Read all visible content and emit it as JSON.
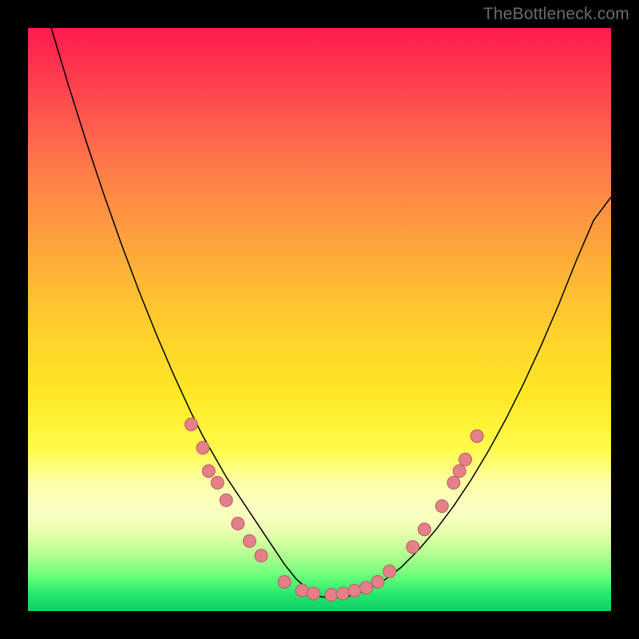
{
  "watermark": "TheBottleneck.com",
  "chart_data": {
    "type": "line",
    "title": "",
    "xlabel": "",
    "ylabel": "",
    "xlim": [
      0,
      100
    ],
    "ylim": [
      0,
      100
    ],
    "grid": false,
    "series": [
      {
        "name": "curve",
        "color": "#000000",
        "stroke_width": 1.5,
        "x": [
          4,
          7,
          10,
          13,
          16,
          19,
          22,
          25,
          28,
          30,
          32,
          34,
          36,
          38,
          40,
          42,
          44,
          46,
          48,
          50,
          52,
          55,
          58,
          61,
          64,
          67,
          70,
          73,
          76,
          79,
          82,
          85,
          88,
          91,
          94,
          97,
          100
        ],
        "y": [
          100,
          90,
          80.5,
          71.5,
          63,
          55,
          47.5,
          40.5,
          34,
          30,
          26.5,
          23,
          20,
          17,
          14,
          11,
          8,
          5.5,
          3.7,
          2.5,
          2.2,
          2.5,
          3.5,
          5.2,
          7.5,
          10.5,
          14,
          18,
          22.5,
          27.5,
          33,
          39,
          45.5,
          52.5,
          60,
          67,
          71
        ]
      }
    ],
    "markers": {
      "color": "#e57f88",
      "stroke": "#b36068",
      "radius_px": 8,
      "points": [
        {
          "x": 28,
          "y": 32
        },
        {
          "x": 30,
          "y": 28
        },
        {
          "x": 31,
          "y": 24
        },
        {
          "x": 32.5,
          "y": 22
        },
        {
          "x": 34,
          "y": 19
        },
        {
          "x": 36,
          "y": 15
        },
        {
          "x": 38,
          "y": 12
        },
        {
          "x": 40,
          "y": 9.5
        },
        {
          "x": 44,
          "y": 5
        },
        {
          "x": 47,
          "y": 3.5
        },
        {
          "x": 49,
          "y": 3
        },
        {
          "x": 52,
          "y": 2.8
        },
        {
          "x": 54,
          "y": 3
        },
        {
          "x": 56,
          "y": 3.5
        },
        {
          "x": 58,
          "y": 4
        },
        {
          "x": 60,
          "y": 5
        },
        {
          "x": 62,
          "y": 6.8
        },
        {
          "x": 66,
          "y": 11
        },
        {
          "x": 68,
          "y": 14
        },
        {
          "x": 71,
          "y": 18
        },
        {
          "x": 73,
          "y": 22
        },
        {
          "x": 74,
          "y": 24
        },
        {
          "x": 75,
          "y": 26
        },
        {
          "x": 77,
          "y": 30
        }
      ]
    }
  }
}
